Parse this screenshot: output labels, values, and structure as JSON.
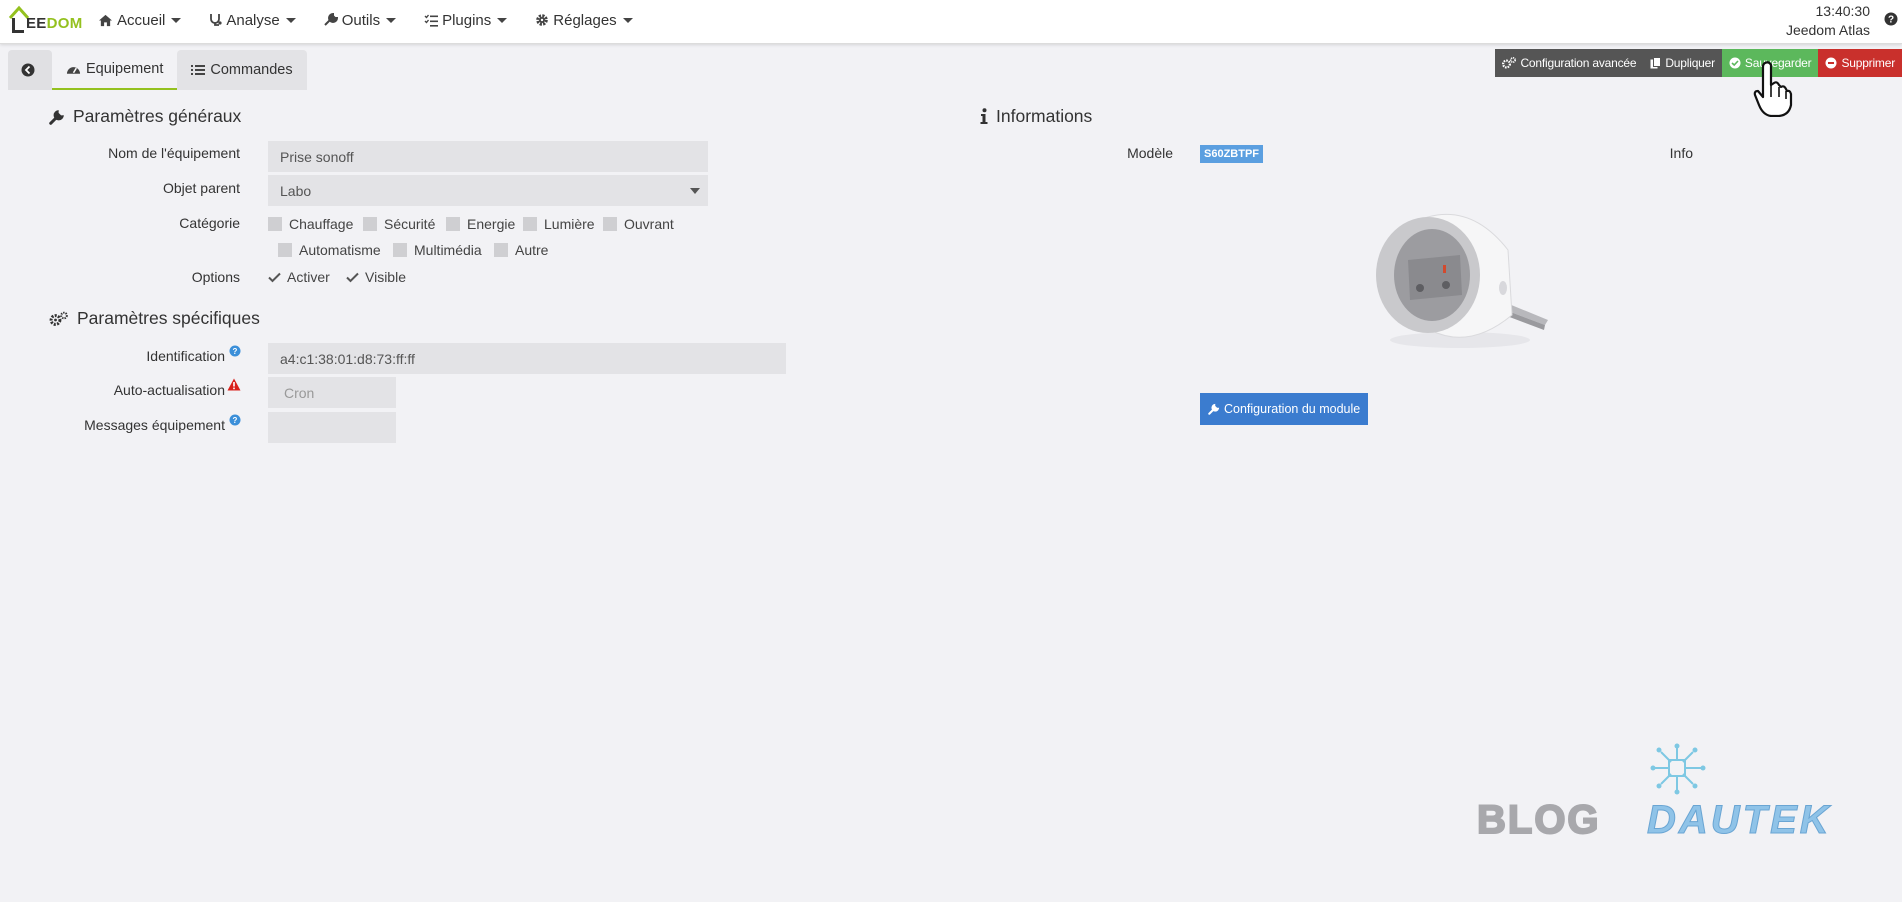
{
  "nav": {
    "logo_a": "EE",
    "logo_b": "DOM",
    "items": [
      {
        "label": "Accueil",
        "icon": "home-icon"
      },
      {
        "label": "Analyse",
        "icon": "stethoscope-icon"
      },
      {
        "label": "Outils",
        "icon": "wrench-icon"
      },
      {
        "label": "Plugins",
        "icon": "tasks-icon"
      },
      {
        "label": "Réglages",
        "icon": "gear-icon"
      }
    ],
    "time": "13:40:30",
    "user": "Jeedom Atlas"
  },
  "tabs": {
    "equipement": "Equipement",
    "commandes": "Commandes"
  },
  "actions": {
    "config_avancee": "Configuration avancée",
    "dupliquer": "Dupliquer",
    "sauvegarder": "Sauvegarder",
    "supprimer": "Supprimer"
  },
  "general": {
    "title": "Paramètres généraux",
    "nom_label": "Nom de l'équipement",
    "nom_value": "Prise sonoff",
    "parent_label": "Objet parent",
    "parent_value": "Labo",
    "categorie_label": "Catégorie",
    "categories": [
      "Chauffage",
      "Sécurité",
      "Energie",
      "Lumière",
      "Ouvrant",
      "Automatisme",
      "Multimédia",
      "Autre"
    ],
    "options_label": "Options",
    "options": [
      "Activer",
      "Visible"
    ]
  },
  "specific": {
    "title": "Paramètres spécifiques",
    "id_label": "Identification",
    "id_value": "a4:c1:38:01:d8:73:ff:ff",
    "auto_label": "Auto-actualisation",
    "auto_placeholder": "Cron",
    "messages_label": "Messages équipement"
  },
  "info": {
    "title": "Informations",
    "modele_label": "Modèle",
    "modele_value": "S60ZBTPF",
    "info_label": "Info",
    "config_module": "Configuration du module"
  },
  "watermark": {
    "a": "BLOG",
    "b": "DAUTEK"
  },
  "colors": {
    "accent": "#94c11f",
    "save": "#5cb85c",
    "delete": "#c9302c",
    "primary": "#3b7ccf",
    "badge": "#5b9fe0"
  }
}
